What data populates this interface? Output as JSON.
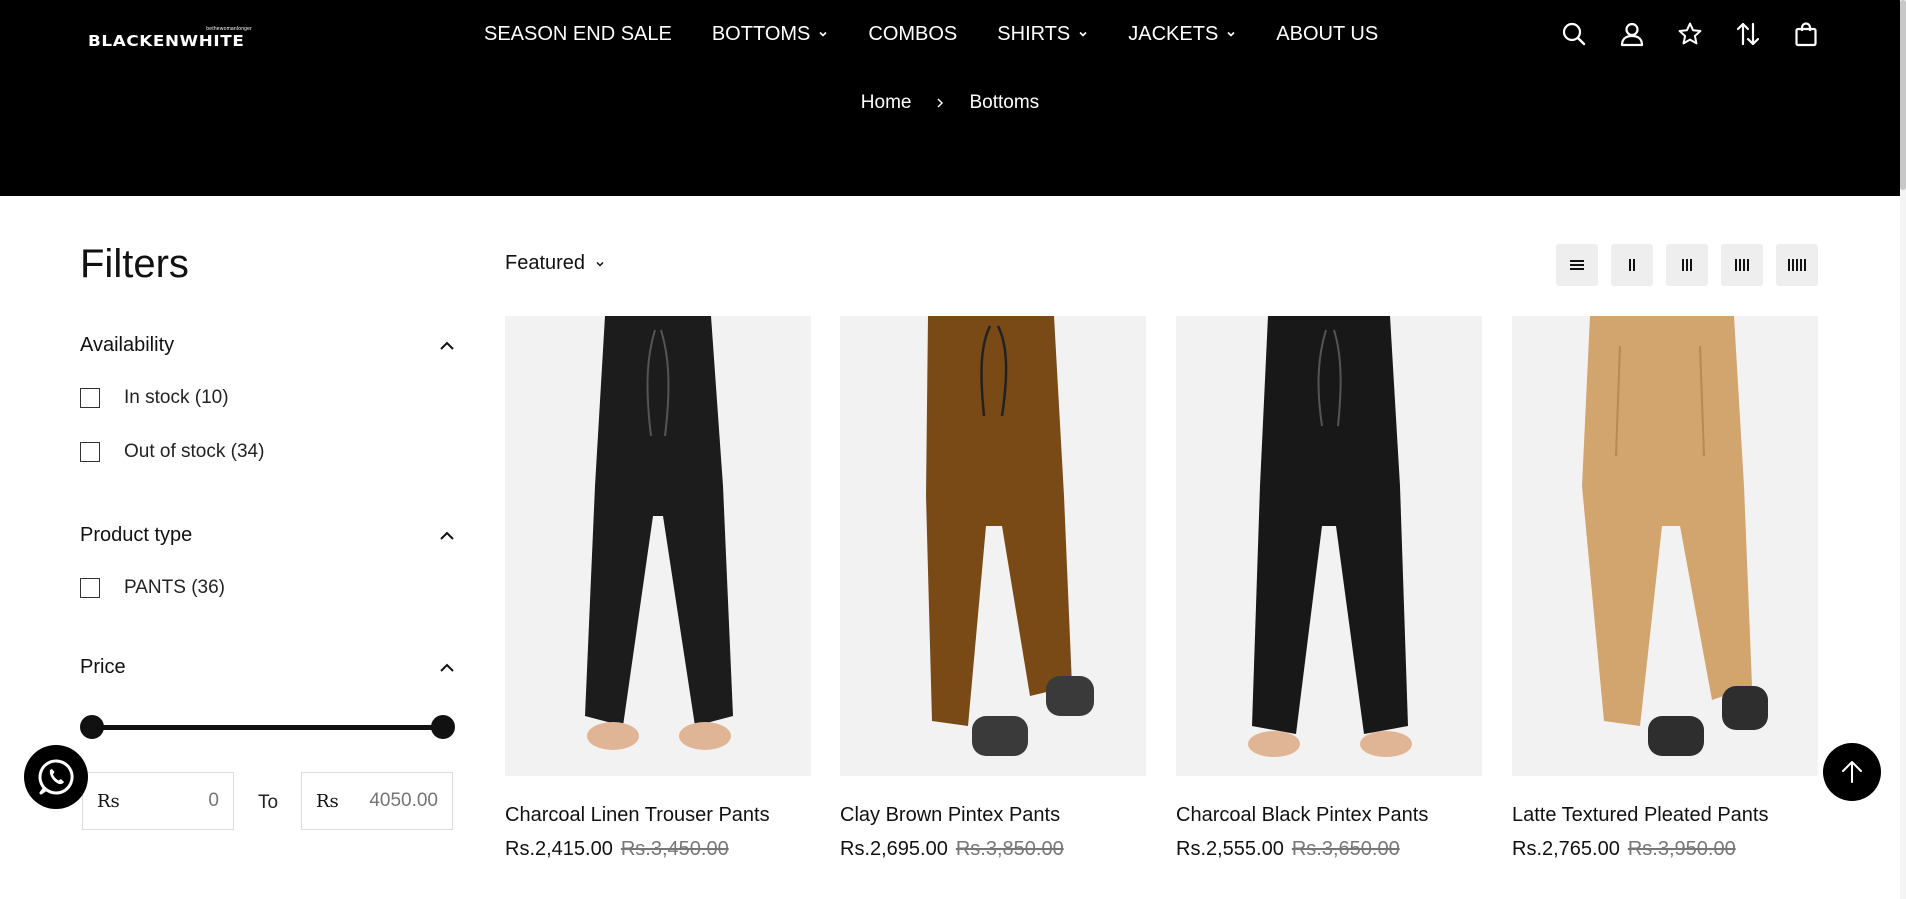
{
  "header": {
    "logo_tagline": "bethewomanlonger",
    "logo_text": "BLACKENWHITE",
    "nav": [
      {
        "label": "SEASON END SALE",
        "dropdown": false
      },
      {
        "label": "BOTTOMS",
        "dropdown": true
      },
      {
        "label": "COMBOS",
        "dropdown": false
      },
      {
        "label": "SHIRTS",
        "dropdown": true
      },
      {
        "label": "JACKETS",
        "dropdown": true
      },
      {
        "label": "ABOUT US",
        "dropdown": false
      }
    ],
    "icons": [
      "search-icon",
      "account-icon",
      "wishlist-star-icon",
      "sort-arrows-icon",
      "cart-bag-icon"
    ]
  },
  "breadcrumb": {
    "home": "Home",
    "current": "Bottoms"
  },
  "filters": {
    "title": "Filters",
    "availability": {
      "label": "Availability",
      "options": [
        {
          "label": "In stock (10)",
          "checked": false
        },
        {
          "label": "Out of stock (34)",
          "checked": false
        }
      ]
    },
    "product_type": {
      "label": "Product type",
      "options": [
        {
          "label": "PANTS (36)",
          "checked": false
        }
      ]
    },
    "price": {
      "label": "Price",
      "currency": "Rs",
      "min_placeholder": "0",
      "max_placeholder": "4050.00",
      "to_label": "To",
      "range_min": 0,
      "range_max": 4050
    }
  },
  "toolbar": {
    "sort_label": "Featured",
    "view_modes": [
      "list-view-icon",
      "grid-2-icon",
      "grid-3-icon",
      "grid-4-icon",
      "grid-5-icon"
    ]
  },
  "products": [
    {
      "title": "Charcoal Linen Trouser Pants",
      "price": "Rs.2,415.00",
      "compare_price": "Rs.3,450.00",
      "color": "#1c1c1c"
    },
    {
      "title": "Clay Brown Pintex Pants",
      "price": "Rs.2,695.00",
      "compare_price": "Rs.3,850.00",
      "color": "#7a4a16"
    },
    {
      "title": "Charcoal Black Pintex Pants",
      "price": "Rs.2,555.00",
      "compare_price": "Rs.3,650.00",
      "color": "#181818"
    },
    {
      "title": "Latte Textured Pleated Pants",
      "price": "Rs.2,765.00",
      "compare_price": "Rs.3,950.00",
      "color": "#d2a46e"
    }
  ],
  "colors": {
    "header_bg": "#000000",
    "accent": "#111111",
    "muted": "#777777",
    "view_button_bg": "#eeeeee"
  }
}
